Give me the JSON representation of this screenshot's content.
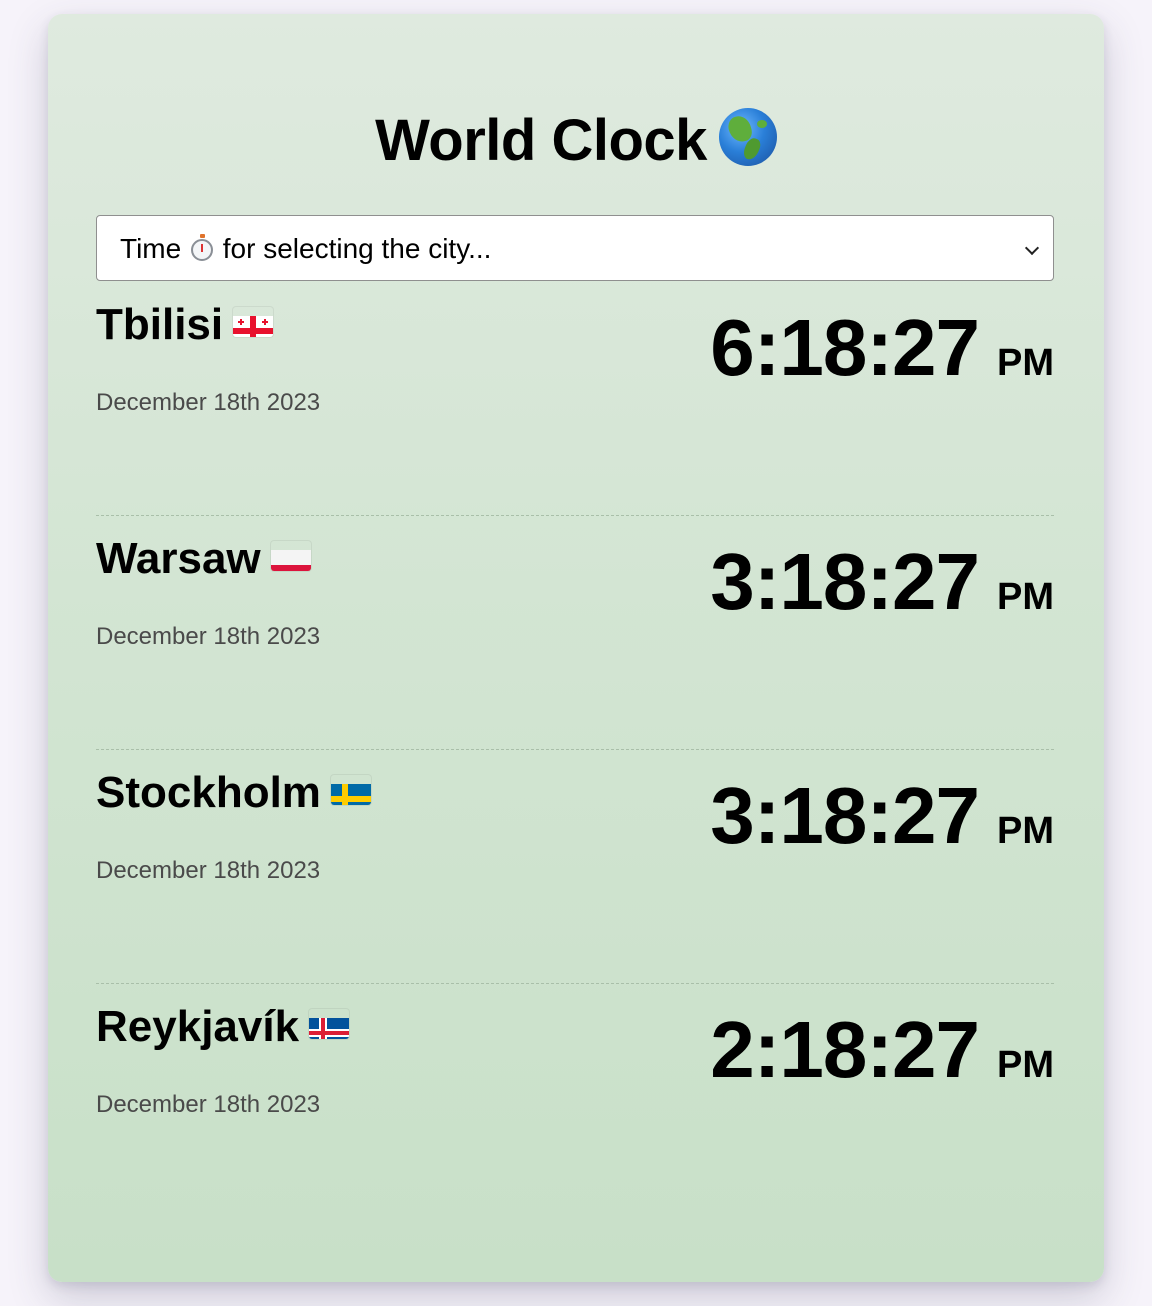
{
  "header": {
    "title": "World Clock"
  },
  "city_select": {
    "text_before_icon": "Time",
    "text_after_icon": "for selecting the city..."
  },
  "cities": [
    {
      "name": "Tbilisi",
      "flag": "flag-georgia",
      "date": "December 18th 2023",
      "time": "6:18:27",
      "ampm": "PM"
    },
    {
      "name": "Warsaw",
      "flag": "flag-poland",
      "date": "December 18th 2023",
      "time": "3:18:27",
      "ampm": "PM"
    },
    {
      "name": "Stockholm",
      "flag": "flag-sweden",
      "date": "December 18th 2023",
      "time": "3:18:27",
      "ampm": "PM"
    },
    {
      "name": "Reykjavík",
      "flag": "flag-iceland",
      "date": "December 18th 2023",
      "time": "2:18:27",
      "ampm": "PM"
    }
  ],
  "colors": {
    "card_top": "#dfeadf",
    "card_bottom": "#c8e0c8",
    "page_background": "#f6f3fa"
  }
}
